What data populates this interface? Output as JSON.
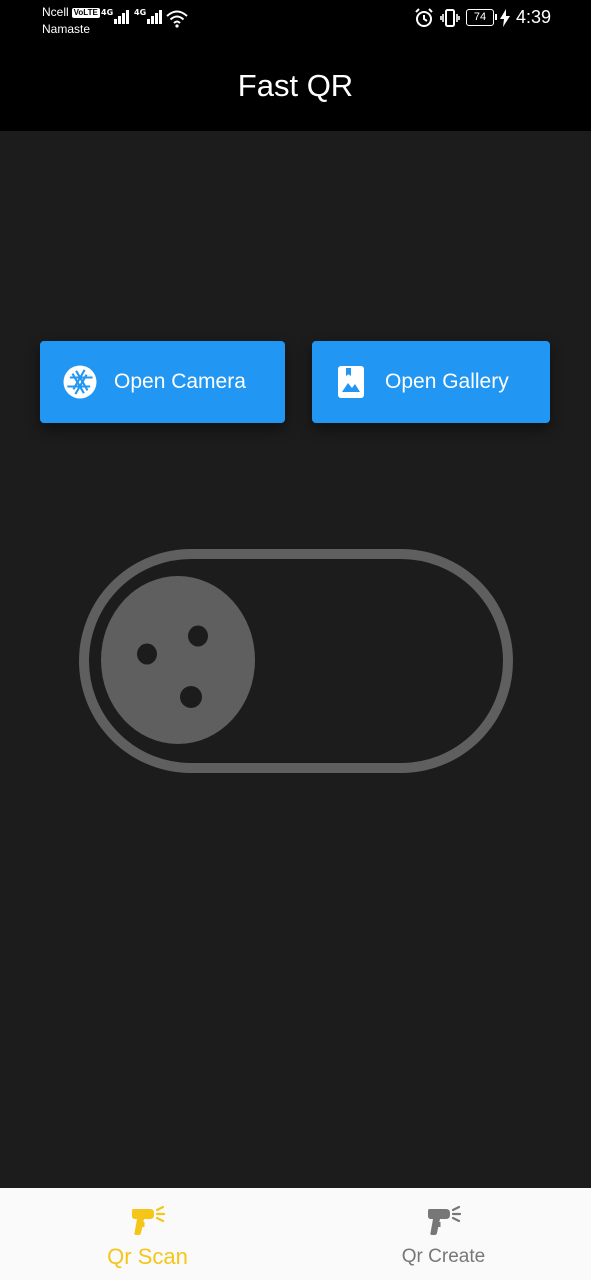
{
  "status_bar": {
    "carrier_name": "Ncell",
    "volte_badge": "VoLTE",
    "network_name": "Namaste",
    "sim1_network": "4G",
    "sim2_network": "4G",
    "battery_level": "74",
    "time": "4:39"
  },
  "app_bar": {
    "title": "Fast QR"
  },
  "actions": {
    "open_camera_label": "Open Camera",
    "open_gallery_label": "Open Gallery"
  },
  "bottom_nav": {
    "items": [
      {
        "label": "Qr Scan",
        "icon": "qr-scanner-icon",
        "active": true
      },
      {
        "label": "Qr Create",
        "icon": "qr-scanner-icon",
        "active": false
      }
    ]
  },
  "colors": {
    "primary": "#2196f3",
    "active_tab": "#f5c518",
    "inactive_tab": "#777777",
    "background": "#1c1c1c",
    "illustration": "#5f5f5f"
  }
}
